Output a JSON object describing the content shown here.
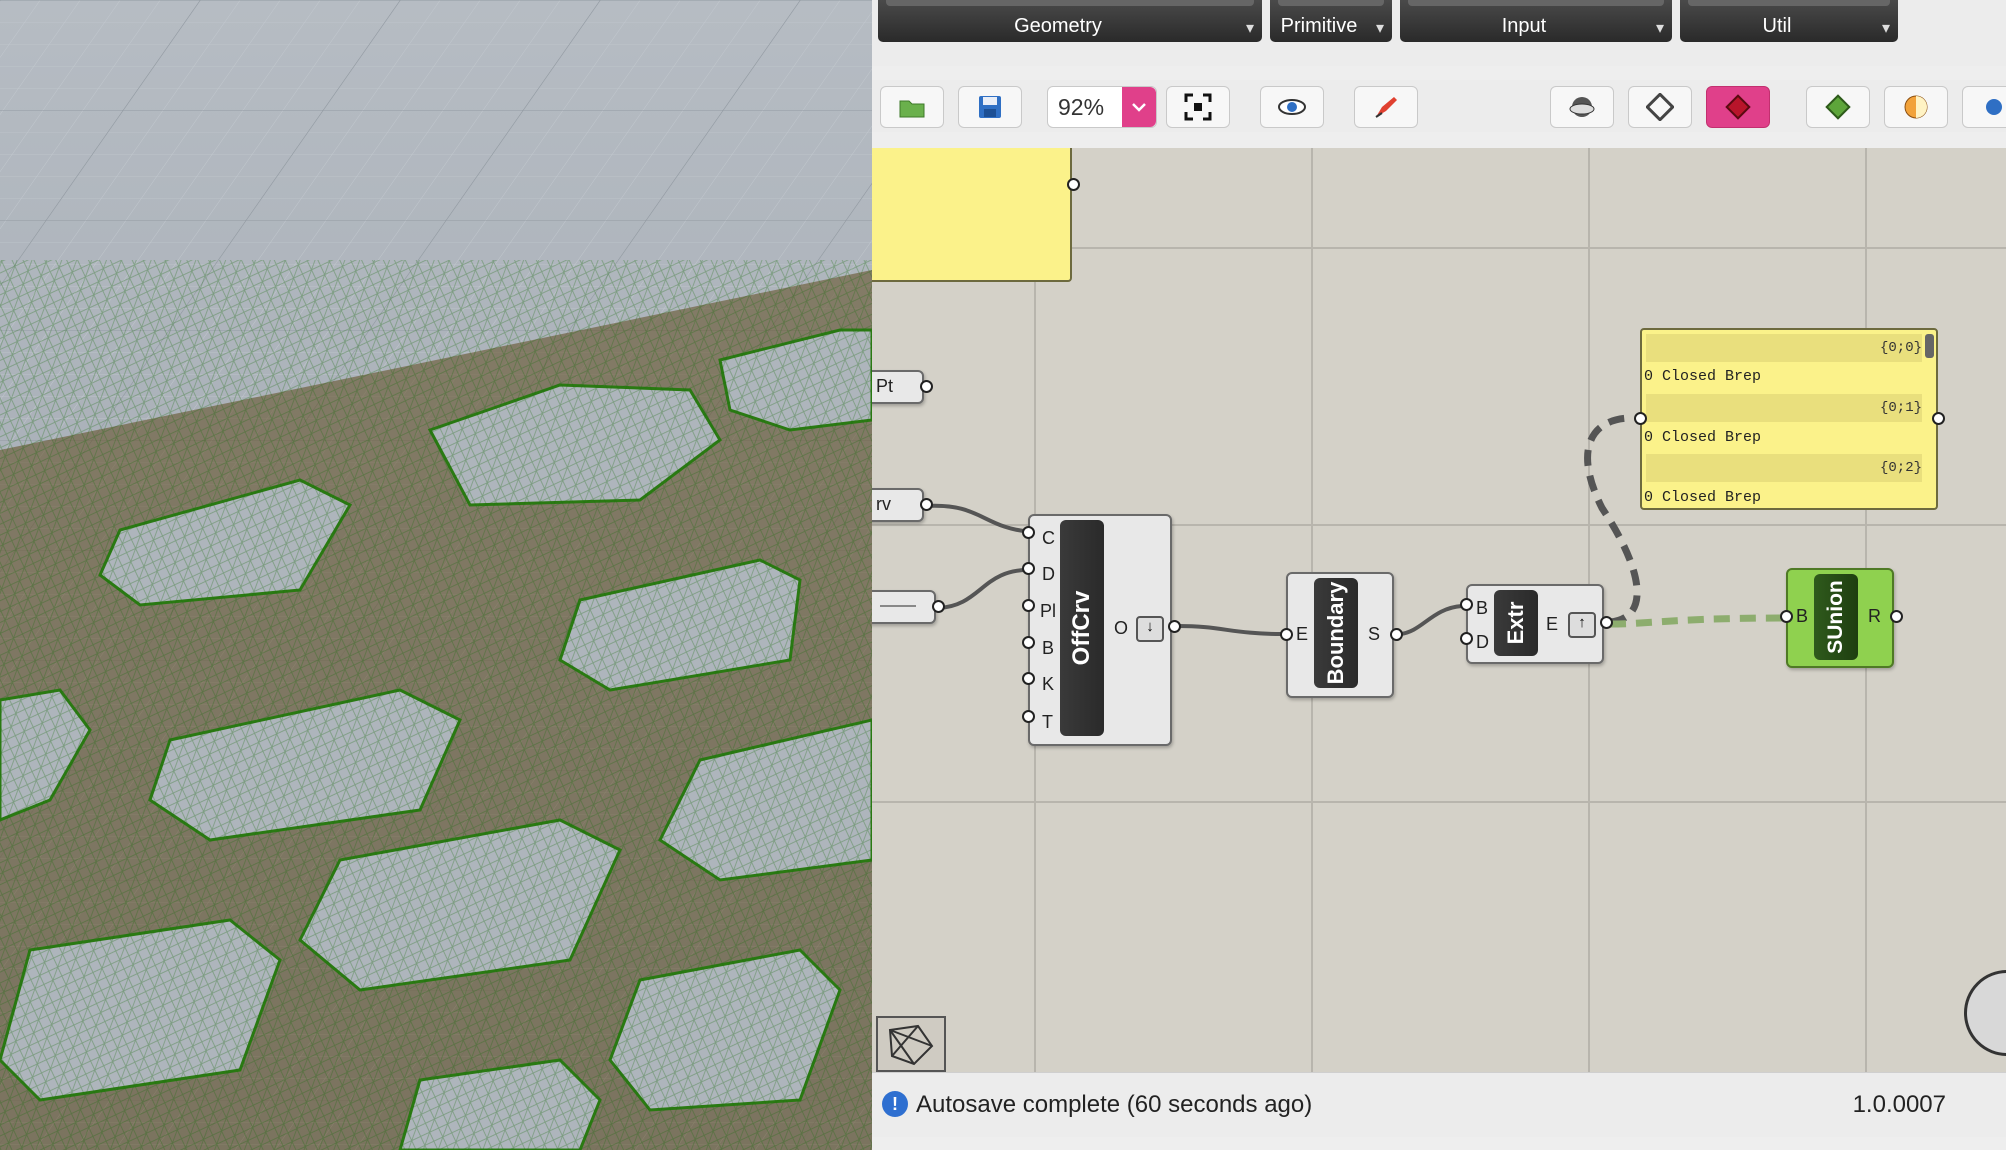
{
  "tabs": {
    "geometry": "Geometry",
    "primitive": "Primitive",
    "input": "Input",
    "util": "Util"
  },
  "toolbar": {
    "zoom": "92%"
  },
  "components": {
    "offcrv": {
      "name": "OffCrv",
      "inputs": [
        "C",
        "D",
        "Pl",
        "B",
        "K",
        "T"
      ],
      "output": "O"
    },
    "boundary": {
      "name": "Boundary",
      "input": "E",
      "output": "S"
    },
    "extr": {
      "name": "Extr",
      "inputs": [
        "B",
        "D"
      ],
      "output": "E"
    },
    "sunion": {
      "name": "SUnion",
      "input": "B",
      "output": "R"
    },
    "left_params": {
      "pt": "Pt",
      "crv": "rv"
    }
  },
  "panel": {
    "paths": [
      "{0;0}",
      "{0;1}",
      "{0;2}"
    ],
    "rows": [
      "0 Closed Brep",
      "0 Closed Brep",
      "0 Closed Brep"
    ]
  },
  "status": {
    "message": "Autosave complete (60 seconds ago)",
    "version": "1.0.0007",
    "info_glyph": "!"
  },
  "colors": {
    "accent_pink": "#e0408a",
    "sunion_green": "#8fd14f",
    "panel_yellow": "#fbf28a",
    "mesh_green": "#2a7a12",
    "mesh_brown": "#6b4b14"
  }
}
